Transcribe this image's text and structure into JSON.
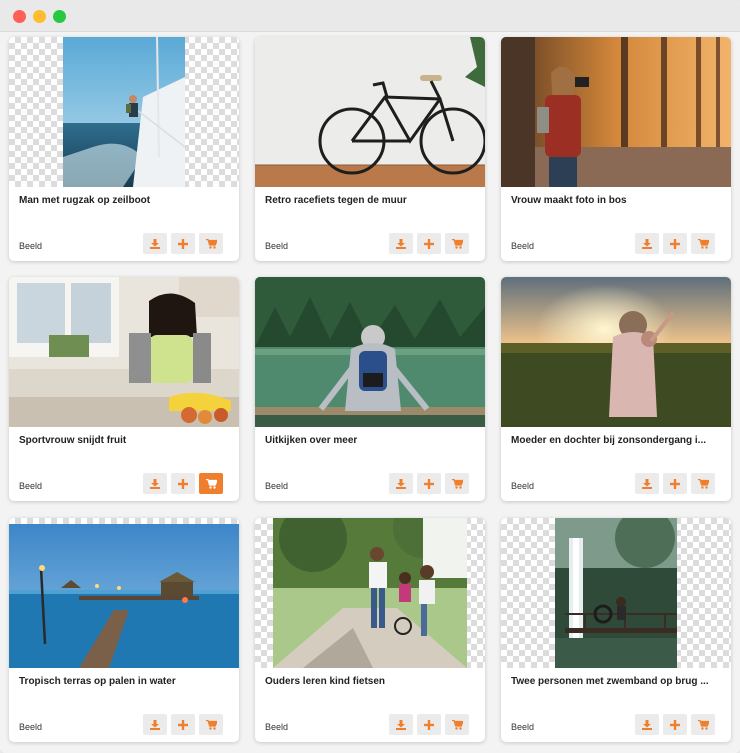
{
  "colors": {
    "accent": "#ef7f2d",
    "button_bg": "#ebebeb"
  },
  "cards": [
    {
      "title": "Man met rugzak op zeilboot",
      "type": "Beeld",
      "cart_active": false
    },
    {
      "title": "Retro racefiets tegen de muur",
      "type": "Beeld",
      "cart_active": false
    },
    {
      "title": "Vrouw maakt foto in bos",
      "type": "Beeld",
      "cart_active": false
    },
    {
      "title": "Sportvrouw snijdt fruit",
      "type": "Beeld",
      "cart_active": true
    },
    {
      "title": "Uitkijken over meer",
      "type": "Beeld",
      "cart_active": false
    },
    {
      "title": "Moeder en dochter bij zonsondergang i...",
      "type": "Beeld",
      "cart_active": false
    },
    {
      "title": "Tropisch terras op palen in water",
      "type": "Beeld",
      "cart_active": false
    },
    {
      "title": "Ouders leren kind fietsen",
      "type": "Beeld",
      "cart_active": false
    },
    {
      "title": "Twee personen met zwemband op brug ...",
      "type": "Beeld",
      "cart_active": false
    }
  ],
  "icons": [
    "download-icon",
    "plus-icon",
    "cart-icon"
  ]
}
